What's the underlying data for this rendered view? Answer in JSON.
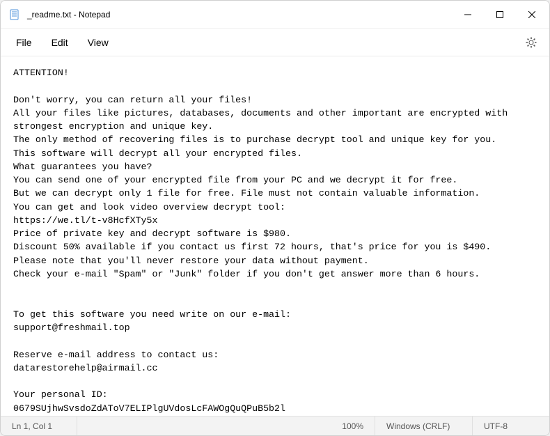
{
  "titlebar": {
    "title": "_readme.txt - Notepad"
  },
  "menubar": {
    "file": "File",
    "edit": "Edit",
    "view": "View"
  },
  "document": {
    "text": "ATTENTION!\n\nDon't worry, you can return all your files!\nAll your files like pictures, databases, documents and other important are encrypted with strongest encryption and unique key.\nThe only method of recovering files is to purchase decrypt tool and unique key for you.\nThis software will decrypt all your encrypted files.\nWhat guarantees you have?\nYou can send one of your encrypted file from your PC and we decrypt it for free.\nBut we can decrypt only 1 file for free. File must not contain valuable information.\nYou can get and look video overview decrypt tool:\nhttps://we.tl/t-v8HcfXTy5x\nPrice of private key and decrypt software is $980.\nDiscount 50% available if you contact us first 72 hours, that's price for you is $490.\nPlease note that you'll never restore your data without payment.\nCheck your e-mail \"Spam\" or \"Junk\" folder if you don't get answer more than 6 hours.\n\n\nTo get this software you need write on our e-mail:\nsupport@freshmail.top\n\nReserve e-mail address to contact us:\ndatarestorehelp@airmail.cc\n\nYour personal ID:\n0679SUjhwSvsdoZdAToV7ELIPlgUVdosLcFAWOgQuQPuB5b2l"
  },
  "statusbar": {
    "position": "Ln 1, Col 1",
    "zoom": "100%",
    "line_ending": "Windows (CRLF)",
    "encoding": "UTF-8"
  }
}
